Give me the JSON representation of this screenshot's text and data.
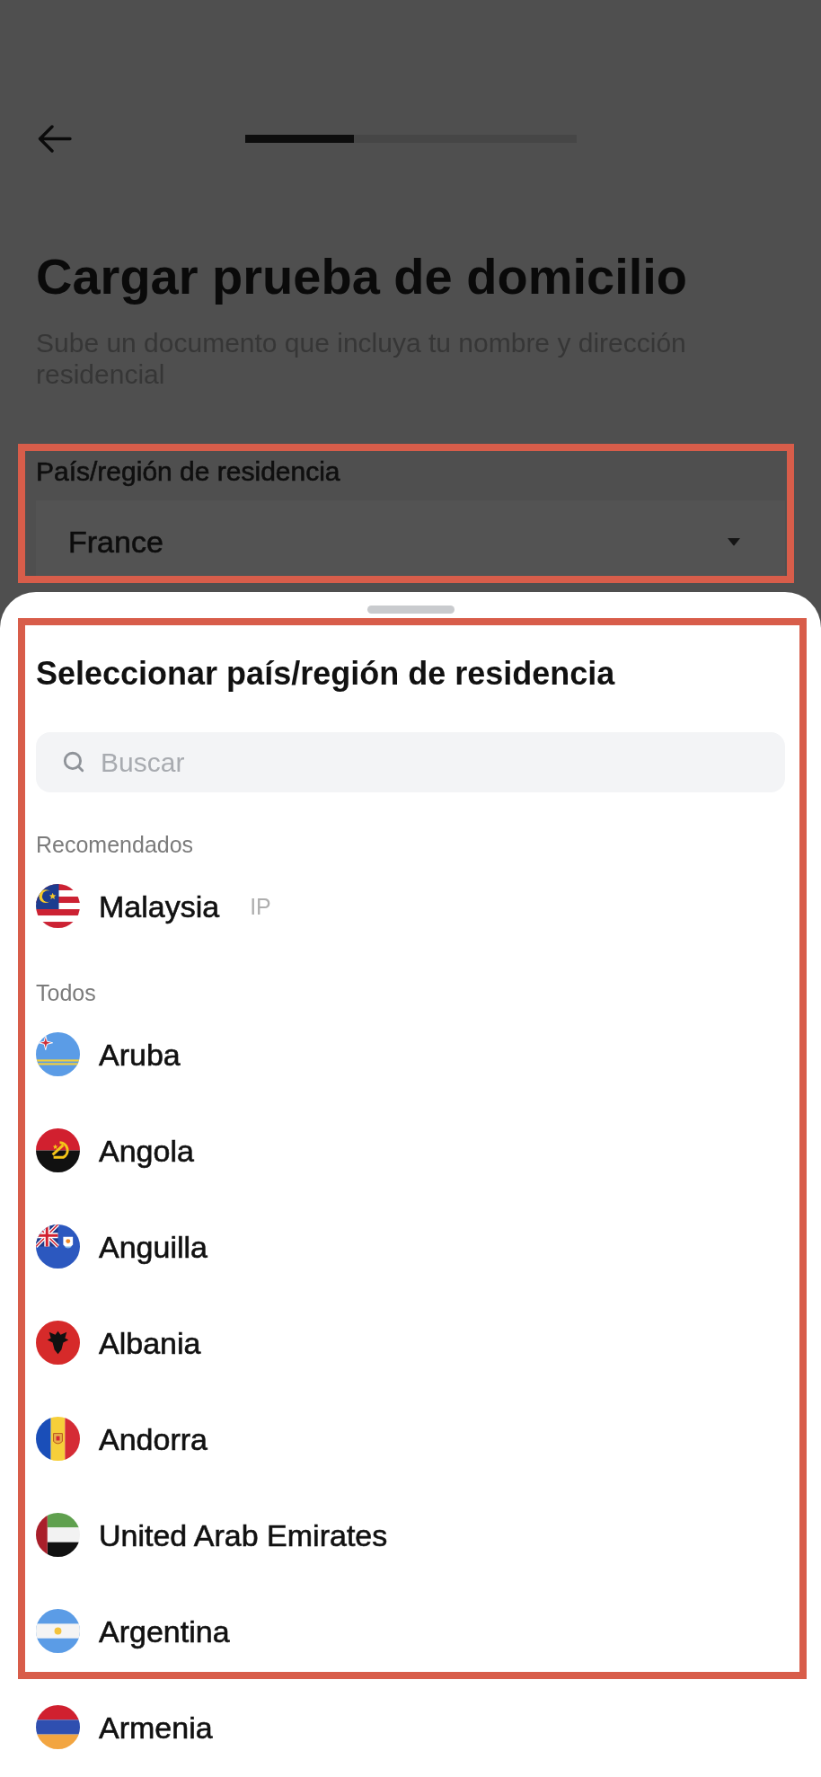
{
  "progress": {
    "level": 0.33
  },
  "page": {
    "title": "Cargar prueba de domicilio",
    "subtitle": "Sube un documento que incluya tu nombre y dirección residencial"
  },
  "country_field": {
    "label": "País/región de residencia",
    "value": "France",
    "highlighted": true
  },
  "sheet": {
    "title": "Seleccionar país/región de residencia",
    "highlighted": true,
    "search": {
      "placeholder": "Buscar"
    },
    "sections": [
      {
        "heading": "Recomendados",
        "items": [
          {
            "name": "Malaysia",
            "kind": "malaysia",
            "tag": "IP"
          }
        ]
      },
      {
        "heading": "Todos",
        "items": [
          {
            "name": "Aruba",
            "kind": "aruba"
          },
          {
            "name": "Angola",
            "kind": "angola"
          },
          {
            "name": "Anguilla",
            "kind": "anguilla"
          },
          {
            "name": "Albania",
            "kind": "albania"
          },
          {
            "name": "Andorra",
            "kind": "andorra"
          },
          {
            "name": "United Arab Emirates",
            "kind": "uae"
          },
          {
            "name": "Argentina",
            "kind": "argentina"
          },
          {
            "name": "Armenia",
            "kind": "armenia"
          }
        ]
      }
    ]
  }
}
